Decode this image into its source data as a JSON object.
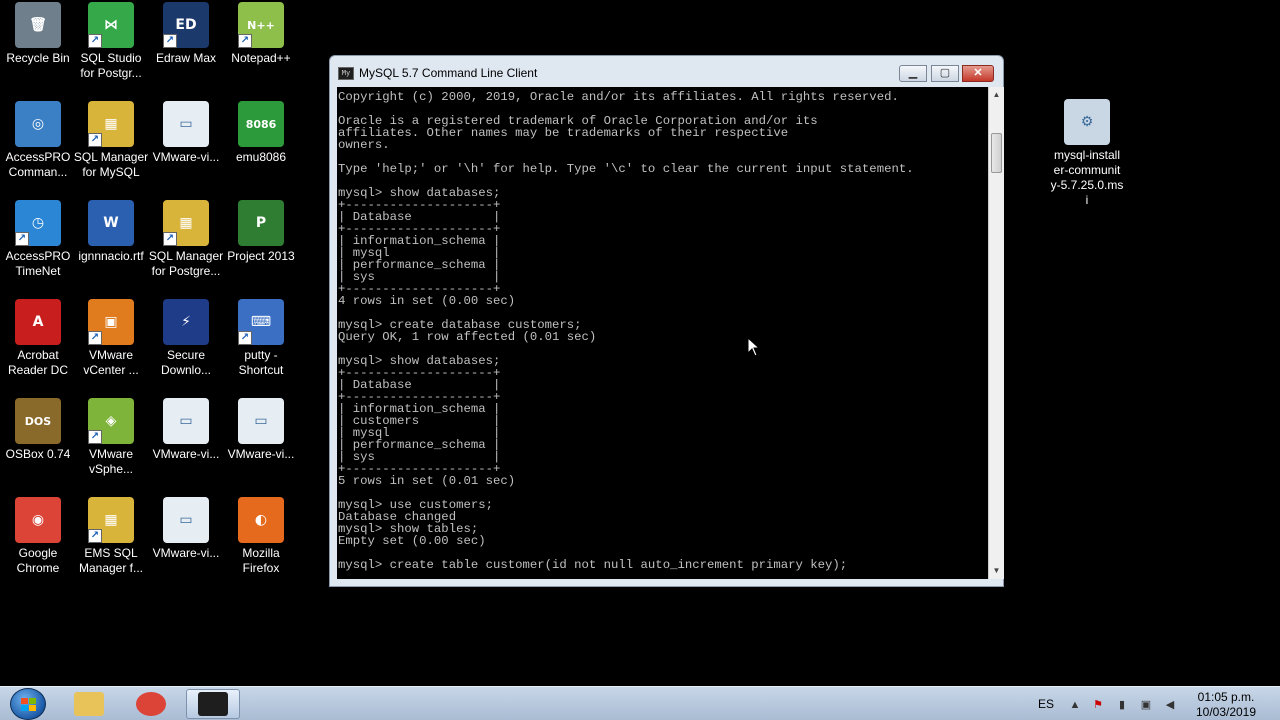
{
  "desktop_icons": [
    {
      "id": "recycle-bin",
      "label": "Recycle Bin",
      "icon": "recycle-bin-icon",
      "color": "#6f7f8c",
      "glyph": "🗑",
      "shortcut": false
    },
    {
      "id": "sql-studio-postgres",
      "label": "SQL Studio\nfor Postgr...",
      "icon": "sql-studio-icon",
      "color": "#35a94a",
      "glyph": "⋈",
      "shortcut": true
    },
    {
      "id": "edraw-max",
      "label": "Edraw Max",
      "icon": "edraw-icon",
      "color": "#1b3a6b",
      "glyph": "ED",
      "shortcut": true
    },
    {
      "id": "notepad-plus",
      "label": "Notepad++",
      "icon": "notepad-plus-icon",
      "color": "#8fbf4b",
      "glyph": "N++",
      "shortcut": true
    },
    {
      "id": "accesspro-command",
      "label": "AccessPRO\nComman...",
      "icon": "accesspro-command-icon",
      "color": "#3b7fc4",
      "glyph": "◎",
      "shortcut": false
    },
    {
      "id": "sql-manager-mysql",
      "label": "SQL Manager\nfor MySQL",
      "icon": "sql-manager-icon",
      "color": "#d9b43a",
      "glyph": "▦",
      "shortcut": true
    },
    {
      "id": "vmware-vi-1",
      "label": "VMware-vi...",
      "icon": "vmware-file-icon",
      "color": "#e6edf3",
      "glyph": "▭",
      "shortcut": false
    },
    {
      "id": "emu8086",
      "label": "emu8086",
      "icon": "emu8086-icon",
      "color": "#2c9a3a",
      "glyph": "8086",
      "shortcut": false
    },
    {
      "id": "accesspro-timenet",
      "label": "AccessPRO\nTimeNet",
      "icon": "timenet-icon",
      "color": "#2b87d6",
      "glyph": "◷",
      "shortcut": true
    },
    {
      "id": "ignnnacio-rtf",
      "label": "ignnnacio.rtf",
      "icon": "word-doc-icon",
      "color": "#2b5fb0",
      "glyph": "W",
      "shortcut": false
    },
    {
      "id": "sql-manager-postgres",
      "label": "SQL Manager\nfor Postgre...",
      "icon": "sql-manager-postgres-icon",
      "color": "#d9b43a",
      "glyph": "▦",
      "shortcut": true
    },
    {
      "id": "project-2013",
      "label": "Project 2013",
      "icon": "project-icon",
      "color": "#2e7d32",
      "glyph": "P",
      "shortcut": false
    },
    {
      "id": "acrobat-reader",
      "label": "Acrobat\nReader DC",
      "icon": "acrobat-icon",
      "color": "#c81e1e",
      "glyph": "A",
      "shortcut": false
    },
    {
      "id": "vmware-vcenter",
      "label": "VMware\nvCenter ...",
      "icon": "vcenter-icon",
      "color": "#e07b1e",
      "glyph": "▣",
      "shortcut": true
    },
    {
      "id": "secure-download",
      "label": "Secure\nDownlo...",
      "icon": "secure-download-icon",
      "color": "#1f3c88",
      "glyph": "⚡",
      "shortcut": false
    },
    {
      "id": "putty-shortcut",
      "label": "putty -\nShortcut",
      "icon": "putty-icon",
      "color": "#3a6fc4",
      "glyph": "⌨",
      "shortcut": true
    },
    {
      "id": "dosbox",
      "label": "OSBox 0.74",
      "icon": "dosbox-icon",
      "color": "#8a6a2a",
      "glyph": "DOS",
      "shortcut": false
    },
    {
      "id": "vmware-vsphere",
      "label": "VMware\nvSphe...",
      "icon": "vsphere-icon",
      "color": "#7fb43a",
      "glyph": "◈",
      "shortcut": true
    },
    {
      "id": "vmware-vi-2",
      "label": "VMware-vi...",
      "icon": "vmware-file-icon",
      "color": "#e6edf3",
      "glyph": "▭",
      "shortcut": false
    },
    {
      "id": "vmware-vi-3",
      "label": "VMware-vi...",
      "icon": "vmware-file-icon",
      "color": "#e6edf3",
      "glyph": "▭",
      "shortcut": false
    },
    {
      "id": "google-chrome",
      "label": "Google\nChrome",
      "icon": "chrome-icon",
      "color": "#db4437",
      "glyph": "◉",
      "shortcut": false
    },
    {
      "id": "ems-sql-manager",
      "label": "EMS SQL\nManager f...",
      "icon": "ems-sql-icon",
      "color": "#d9b43a",
      "glyph": "▦",
      "shortcut": true
    },
    {
      "id": "vmware-vi-4",
      "label": "VMware-vi...",
      "icon": "vmware-file-icon",
      "color": "#e6edf3",
      "glyph": "▭",
      "shortcut": false
    },
    {
      "id": "mozilla-firefox",
      "label": "Mozilla\nFirefox",
      "icon": "firefox-icon",
      "color": "#e66a1e",
      "glyph": "◐",
      "shortcut": false
    },
    {
      "id": "mysql-installer",
      "label": "mysql-install\ner-communit\ny-5.7.25.0.ms\ni",
      "icon": "msi-installer-icon",
      "color": "#c9d6e3",
      "glyph": "⚙",
      "shortcut": false
    }
  ],
  "window": {
    "title": "MySQL 5.7 Command Line Client",
    "console_lines": [
      "Copyright (c) 2000, 2019, Oracle and/or its affiliates. All rights reserved.",
      "",
      "Oracle is a registered trademark of Oracle Corporation and/or its",
      "affiliates. Other names may be trademarks of their respective",
      "owners.",
      "",
      "Type 'help;' or '\\h' for help. Type '\\c' to clear the current input statement.",
      "",
      "mysql> show databases;",
      "+--------------------+",
      "| Database           |",
      "+--------------------+",
      "| information_schema |",
      "| mysql              |",
      "| performance_schema |",
      "| sys                |",
      "+--------------------+",
      "4 rows in set (0.00 sec)",
      "",
      "mysql> create database customers;",
      "Query OK, 1 row affected (0.01 sec)",
      "",
      "mysql> show databases;",
      "+--------------------+",
      "| Database           |",
      "+--------------------+",
      "| information_schema |",
      "| customers          |",
      "| mysql              |",
      "| performance_schema |",
      "| sys                |",
      "+--------------------+",
      "5 rows in set (0.01 sec)",
      "",
      "mysql> use customers;",
      "Database changed",
      "mysql> show tables;",
      "Empty set (0.00 sec)",
      "",
      "mysql> create table customer(id not null auto_increment primary key);"
    ]
  },
  "taskbar": {
    "buttons": [
      {
        "id": "explorer",
        "icon": "folder-icon",
        "color": "#e8c35a",
        "active": false
      },
      {
        "id": "chrome",
        "icon": "chrome-icon",
        "color": "#db4437",
        "active": false
      },
      {
        "id": "mysql-client",
        "icon": "mysql-console-icon",
        "color": "#1e1e1e",
        "active": true
      }
    ],
    "language": "ES",
    "time": "01:05 p.m.",
    "date": "10/03/2019"
  }
}
